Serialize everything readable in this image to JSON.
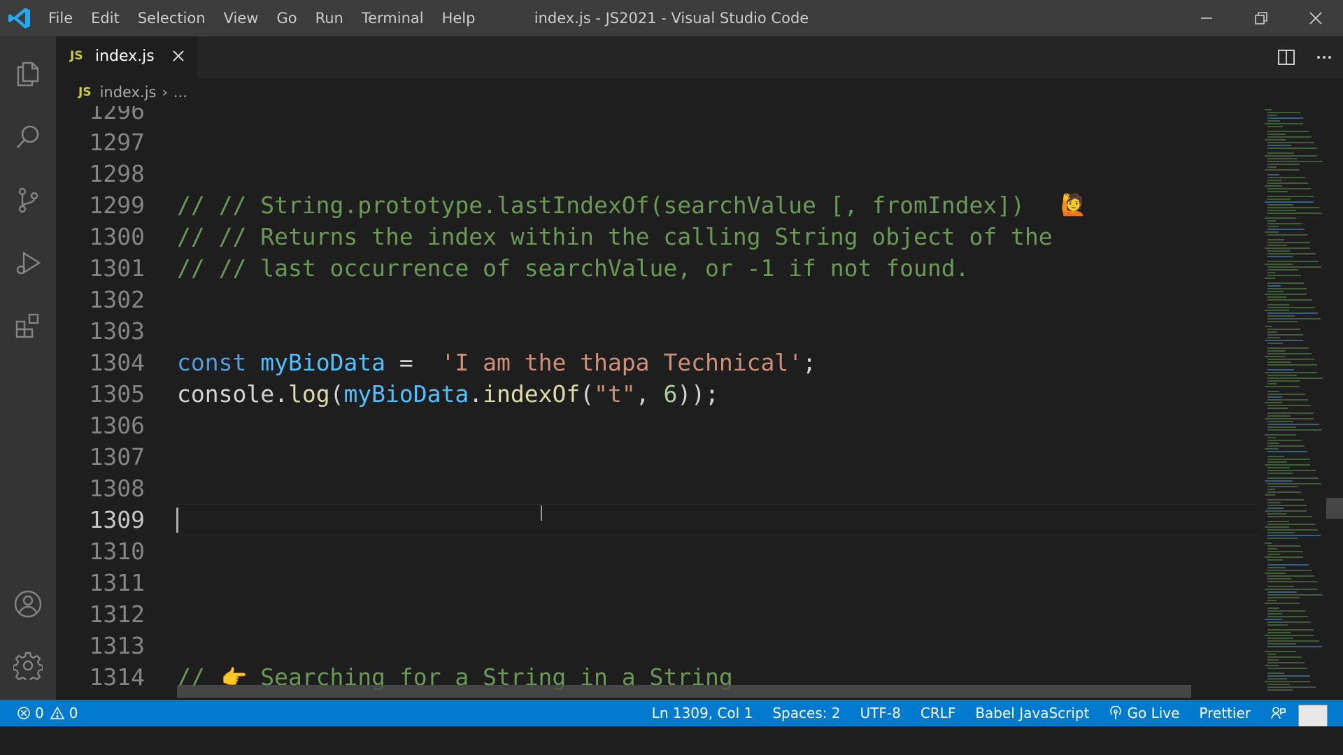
{
  "menu": [
    "File",
    "Edit",
    "Selection",
    "View",
    "Go",
    "Run",
    "Terminal",
    "Help"
  ],
  "window_title": "index.js - JS2021 - Visual Studio Code",
  "tab": {
    "badge": "JS",
    "label": "index.js"
  },
  "breadcrumb": {
    "badge": "JS",
    "file": "index.js",
    "more": "..."
  },
  "editor": {
    "lines": [
      {
        "num": "1296",
        "text": ""
      },
      {
        "num": "1297",
        "text": ""
      },
      {
        "num": "1298",
        "text": ""
      },
      {
        "num": "1299",
        "text": "// // String.prototype.lastIndexOf(searchValue [, fromIndex])"
      },
      {
        "num": "1300",
        "text": "// // Returns the index within the calling String object of the"
      },
      {
        "num": "1301",
        "text": "// // last occurrence of searchValue, or -1 if not found."
      },
      {
        "num": "1302",
        "text": ""
      },
      {
        "num": "1303",
        "text": ""
      },
      {
        "num": "1304",
        "text": "const myBioData =  'I am the thapa Technical';"
      },
      {
        "num": "1305",
        "text": "console.log(myBioData.indexOf(\"t\", 6));"
      },
      {
        "num": "1306",
        "text": ""
      },
      {
        "num": "1307",
        "text": ""
      },
      {
        "num": "1308",
        "text": ""
      },
      {
        "num": "1309",
        "text": ""
      },
      {
        "num": "1310",
        "text": ""
      },
      {
        "num": "1311",
        "text": ""
      },
      {
        "num": "1312",
        "text": ""
      },
      {
        "num": "1313",
        "text": ""
      },
      {
        "num": "1314",
        "text": "//    Searching for a String in a String"
      }
    ],
    "active_line": "1309"
  },
  "status": {
    "errors": "0",
    "warnings": "0",
    "position": "Ln 1309, Col 1",
    "spaces": "Spaces: 2",
    "encoding": "UTF-8",
    "eol": "CRLF",
    "language": "Babel JavaScript",
    "golive": "Go Live",
    "prettier": "Prettier"
  },
  "colors": {
    "statusbar": "#007acc",
    "comment": "#6a9955",
    "keyword": "#569cd6",
    "variable": "#4fc1ff",
    "string": "#ce9178",
    "function": "#dcdcaa"
  }
}
